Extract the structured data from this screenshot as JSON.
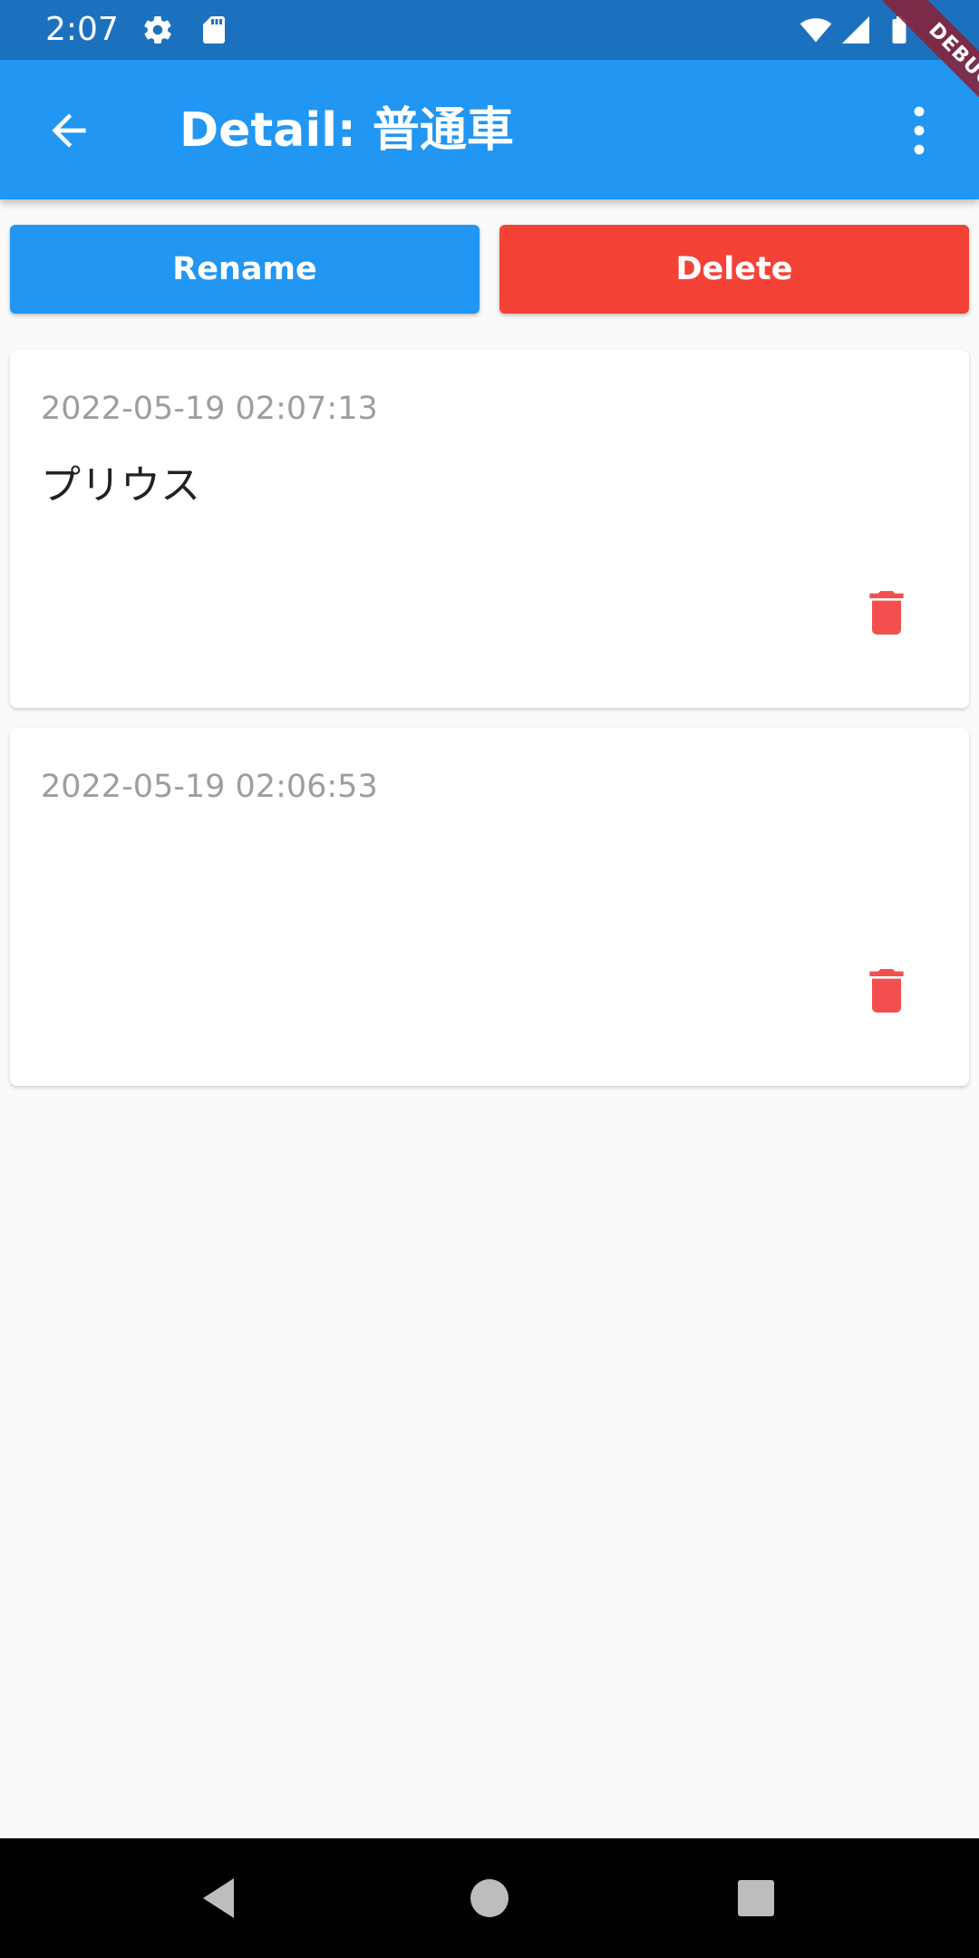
{
  "status": {
    "time": "2:07",
    "icons": [
      "gear-icon",
      "sd-card-icon",
      "wifi-icon",
      "signal-icon",
      "battery-icon"
    ]
  },
  "debug_banner": "DEBUG",
  "app_bar": {
    "title": "Detail: 普通車",
    "back_icon": "arrow-back-icon",
    "menu_icon": "more-vert-icon"
  },
  "actions": {
    "rename_label": "Rename",
    "delete_label": "Delete"
  },
  "items": [
    {
      "timestamp": "2022-05-19 02:07:13",
      "text": "プリウス",
      "delete_icon": "trash-icon"
    },
    {
      "timestamp": "2022-05-19 02:06:53",
      "text": "",
      "delete_icon": "trash-icon"
    }
  ],
  "nav": {
    "icons": [
      "back-triangle-icon",
      "home-circle-icon",
      "recents-square-icon"
    ]
  },
  "colors": {
    "status_bar": "#1c71bf",
    "primary": "#2196f3",
    "danger": "#f44336",
    "trash": "#f44f4f",
    "background": "#fafafa",
    "timestamp_text": "#9e9e9e"
  }
}
